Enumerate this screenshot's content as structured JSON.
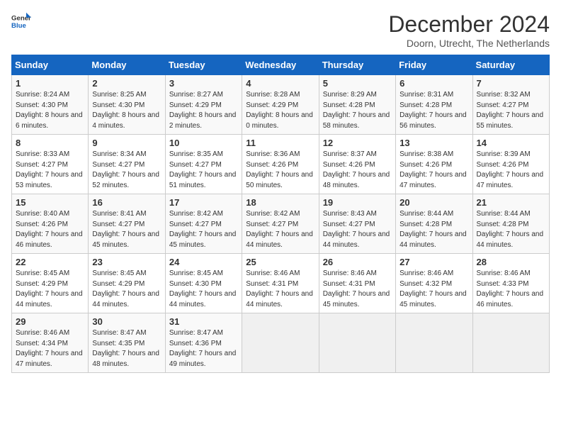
{
  "logo": {
    "general": "General",
    "blue": "Blue"
  },
  "title": "December 2024",
  "location": "Doorn, Utrecht, The Netherlands",
  "days_of_week": [
    "Sunday",
    "Monday",
    "Tuesday",
    "Wednesday",
    "Thursday",
    "Friday",
    "Saturday"
  ],
  "weeks": [
    [
      {
        "day": "1",
        "sunrise": "8:24 AM",
        "sunset": "4:30 PM",
        "daylight": "8 hours and 6 minutes."
      },
      {
        "day": "2",
        "sunrise": "8:25 AM",
        "sunset": "4:30 PM",
        "daylight": "8 hours and 4 minutes."
      },
      {
        "day": "3",
        "sunrise": "8:27 AM",
        "sunset": "4:29 PM",
        "daylight": "8 hours and 2 minutes."
      },
      {
        "day": "4",
        "sunrise": "8:28 AM",
        "sunset": "4:29 PM",
        "daylight": "8 hours and 0 minutes."
      },
      {
        "day": "5",
        "sunrise": "8:29 AM",
        "sunset": "4:28 PM",
        "daylight": "7 hours and 58 minutes."
      },
      {
        "day": "6",
        "sunrise": "8:31 AM",
        "sunset": "4:28 PM",
        "daylight": "7 hours and 56 minutes."
      },
      {
        "day": "7",
        "sunrise": "8:32 AM",
        "sunset": "4:27 PM",
        "daylight": "7 hours and 55 minutes."
      }
    ],
    [
      {
        "day": "8",
        "sunrise": "8:33 AM",
        "sunset": "4:27 PM",
        "daylight": "7 hours and 53 minutes."
      },
      {
        "day": "9",
        "sunrise": "8:34 AM",
        "sunset": "4:27 PM",
        "daylight": "7 hours and 52 minutes."
      },
      {
        "day": "10",
        "sunrise": "8:35 AM",
        "sunset": "4:27 PM",
        "daylight": "7 hours and 51 minutes."
      },
      {
        "day": "11",
        "sunrise": "8:36 AM",
        "sunset": "4:26 PM",
        "daylight": "7 hours and 50 minutes."
      },
      {
        "day": "12",
        "sunrise": "8:37 AM",
        "sunset": "4:26 PM",
        "daylight": "7 hours and 48 minutes."
      },
      {
        "day": "13",
        "sunrise": "8:38 AM",
        "sunset": "4:26 PM",
        "daylight": "7 hours and 47 minutes."
      },
      {
        "day": "14",
        "sunrise": "8:39 AM",
        "sunset": "4:26 PM",
        "daylight": "7 hours and 47 minutes."
      }
    ],
    [
      {
        "day": "15",
        "sunrise": "8:40 AM",
        "sunset": "4:26 PM",
        "daylight": "7 hours and 46 minutes."
      },
      {
        "day": "16",
        "sunrise": "8:41 AM",
        "sunset": "4:27 PM",
        "daylight": "7 hours and 45 minutes."
      },
      {
        "day": "17",
        "sunrise": "8:42 AM",
        "sunset": "4:27 PM",
        "daylight": "7 hours and 45 minutes."
      },
      {
        "day": "18",
        "sunrise": "8:42 AM",
        "sunset": "4:27 PM",
        "daylight": "7 hours and 44 minutes."
      },
      {
        "day": "19",
        "sunrise": "8:43 AM",
        "sunset": "4:27 PM",
        "daylight": "7 hours and 44 minutes."
      },
      {
        "day": "20",
        "sunrise": "8:44 AM",
        "sunset": "4:28 PM",
        "daylight": "7 hours and 44 minutes."
      },
      {
        "day": "21",
        "sunrise": "8:44 AM",
        "sunset": "4:28 PM",
        "daylight": "7 hours and 44 minutes."
      }
    ],
    [
      {
        "day": "22",
        "sunrise": "8:45 AM",
        "sunset": "4:29 PM",
        "daylight": "7 hours and 44 minutes."
      },
      {
        "day": "23",
        "sunrise": "8:45 AM",
        "sunset": "4:29 PM",
        "daylight": "7 hours and 44 minutes."
      },
      {
        "day": "24",
        "sunrise": "8:45 AM",
        "sunset": "4:30 PM",
        "daylight": "7 hours and 44 minutes."
      },
      {
        "day": "25",
        "sunrise": "8:46 AM",
        "sunset": "4:31 PM",
        "daylight": "7 hours and 44 minutes."
      },
      {
        "day": "26",
        "sunrise": "8:46 AM",
        "sunset": "4:31 PM",
        "daylight": "7 hours and 45 minutes."
      },
      {
        "day": "27",
        "sunrise": "8:46 AM",
        "sunset": "4:32 PM",
        "daylight": "7 hours and 45 minutes."
      },
      {
        "day": "28",
        "sunrise": "8:46 AM",
        "sunset": "4:33 PM",
        "daylight": "7 hours and 46 minutes."
      }
    ],
    [
      {
        "day": "29",
        "sunrise": "8:46 AM",
        "sunset": "4:34 PM",
        "daylight": "7 hours and 47 minutes."
      },
      {
        "day": "30",
        "sunrise": "8:47 AM",
        "sunset": "4:35 PM",
        "daylight": "7 hours and 48 minutes."
      },
      {
        "day": "31",
        "sunrise": "8:47 AM",
        "sunset": "4:36 PM",
        "daylight": "7 hours and 49 minutes."
      },
      null,
      null,
      null,
      null
    ]
  ]
}
